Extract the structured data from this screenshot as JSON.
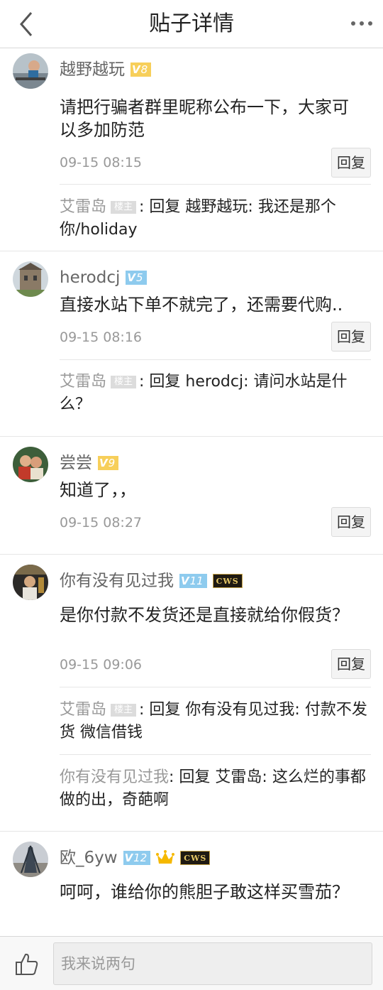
{
  "header": {
    "title": "贴子详情"
  },
  "comments": [
    {
      "username": "越野越玩",
      "level": "8",
      "level_color": "#f7cf5a",
      "text": "请把行骗者群里昵称公布一下，大家可以多加防范",
      "time": "09-15 08:15",
      "reply_label": "回复",
      "replies": [
        {
          "author": "艾雷岛",
          "host_tag": "楼主",
          "content": ": 回复 越野越玩: 我还是那个你/holiday"
        }
      ]
    },
    {
      "username": "herodcj",
      "level": "5",
      "level_color": "#8ecbee",
      "text": "直接水站下单不就完了，还需要代购..",
      "time": "09-15 08:16",
      "reply_label": "回复",
      "replies": [
        {
          "author": "艾雷岛",
          "host_tag": "楼主",
          "content": ": 回复 herodcj: 请问水站是什么？"
        }
      ]
    },
    {
      "username": "尝尝",
      "level": "9",
      "level_color": "#f7cf5a",
      "text": "知道了，，",
      "time": "09-15 08:27",
      "reply_label": "回复",
      "replies": []
    },
    {
      "username": "你有没有见过我",
      "level": "11",
      "level_color": "#8ecbee",
      "badge": "CWS",
      "text": "是你付款不发货还是直接就给你假货？",
      "time": "09-15 09:06",
      "reply_label": "回复",
      "replies": [
        {
          "author": "艾雷岛",
          "host_tag": "楼主",
          "content": ": 回复 你有没有见过我: 付款不发货 微信借钱"
        },
        {
          "author": "你有没有见过我",
          "content": ": 回复 艾雷岛: 这么烂的事都做的出，奇葩啊"
        }
      ]
    },
    {
      "username": "欧_6yw",
      "level": "12",
      "level_color": "#8ecbee",
      "badge": "CWS",
      "crown_icon": "crown-icon",
      "text": "呵呵，谁给你的熊胆子敢这样买雪茄？"
    }
  ],
  "bottom_bar": {
    "input_placeholder": "我来说两句"
  },
  "icons": {
    "back": "chevron-left-icon",
    "more": "more-dots-icon",
    "like": "thumbs-up-icon"
  }
}
